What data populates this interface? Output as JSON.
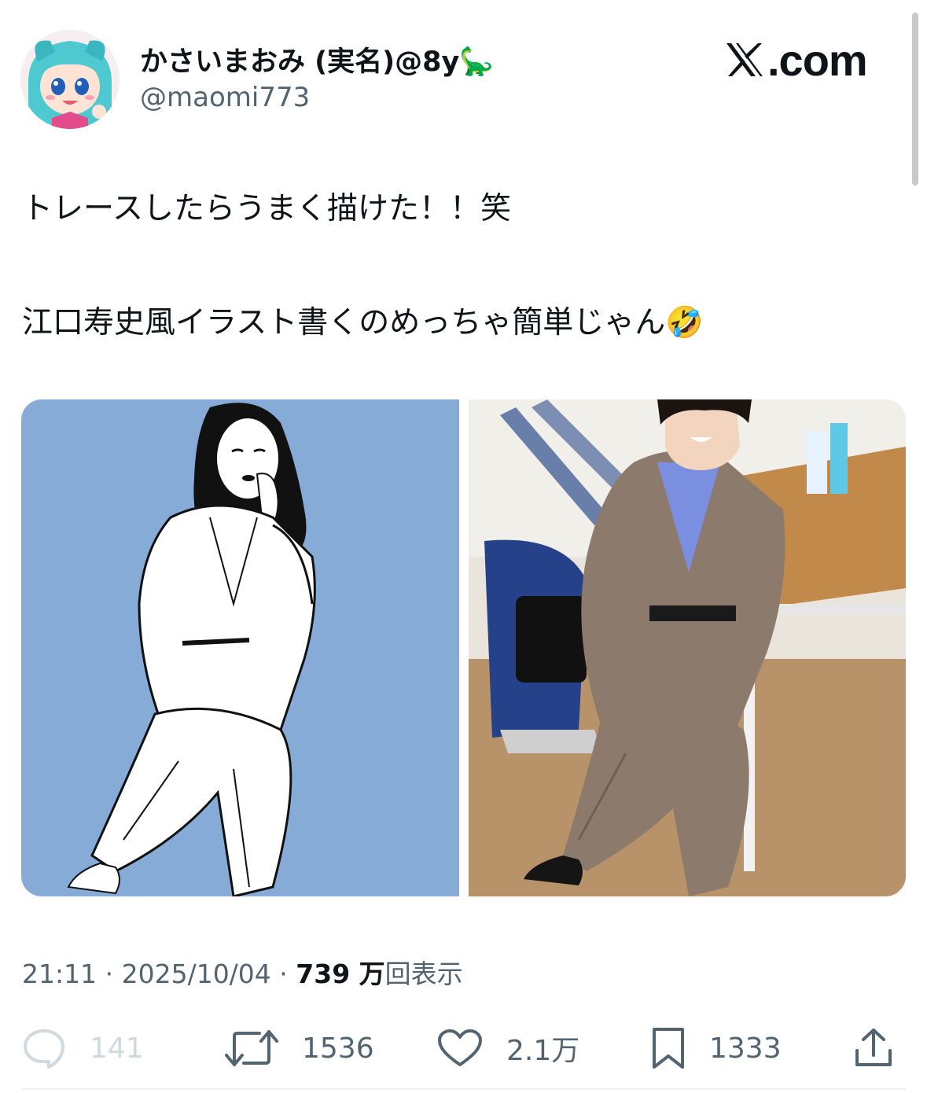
{
  "author": {
    "display_name": "かさいまおみ (実名)@8y🦕",
    "handle": "@maomi773"
  },
  "brand": {
    "logo_text": ".com"
  },
  "tweet": {
    "line1": "トレースしたらうまく描けた！！笑",
    "line2": "江口寿史風イラスト書くのめっちゃ簡単じゃん🤣"
  },
  "meta": {
    "time": "21:11",
    "date": "2025/10/04",
    "views_number": "739 万",
    "views_label": "回表示"
  },
  "actions": {
    "reply_count": "141",
    "retweet_count": "1536",
    "like_count": "2.1万",
    "bookmark_count": "1333"
  },
  "colors": {
    "text": "#0f1419",
    "muted": "#536471",
    "illustration_bg": "#86abd6"
  }
}
